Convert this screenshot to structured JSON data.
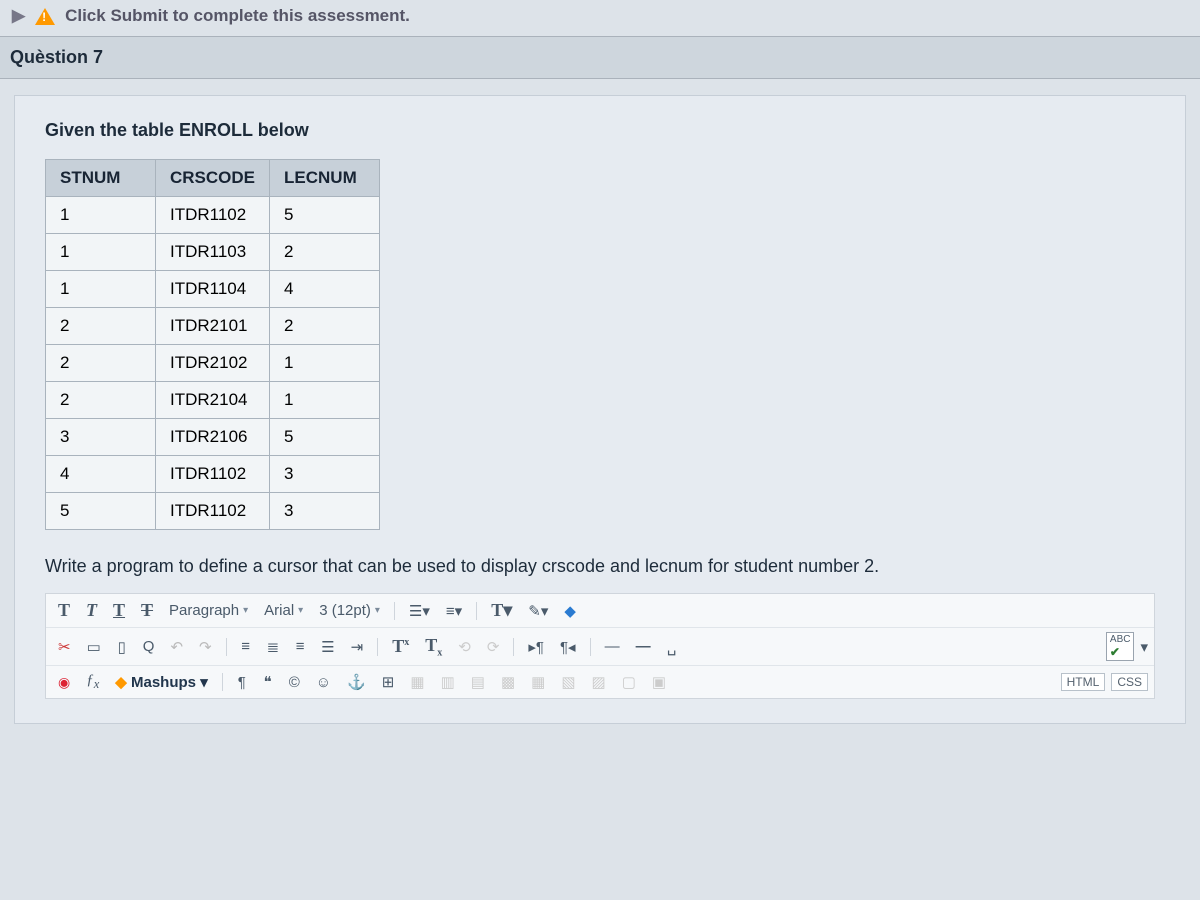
{
  "top": {
    "message_prefix": "Click ",
    "message_bold": "Submit",
    "message_suffix": " to complete this assessment."
  },
  "question_label": "Quèstion 7",
  "prompt": "Given the table ENROLL below",
  "table": {
    "headers": [
      "STNUM",
      "CRSCODE",
      "LECNUM"
    ],
    "rows": [
      [
        "1",
        "ITDR1102",
        "5"
      ],
      [
        "1",
        "ITDR1103",
        "2"
      ],
      [
        "1",
        "ITDR1104",
        "4"
      ],
      [
        "2",
        "ITDR2101",
        "2"
      ],
      [
        "2",
        "ITDR2102",
        "1"
      ],
      [
        "2",
        "ITDR2104",
        "1"
      ],
      [
        "3",
        "ITDR2106",
        "5"
      ],
      [
        "4",
        "ITDR1102",
        "3"
      ],
      [
        "5",
        "ITDR1102",
        "3"
      ]
    ]
  },
  "instruction": "Write a program to define a cursor that can be used to display crscode and lecnum for student number 2.",
  "toolbar": {
    "format": "Paragraph",
    "font": "Arial",
    "size": "3 (12pt)",
    "mashups": "Mashups",
    "html": "HTML",
    "css": "CSS",
    "abc": "ABC"
  }
}
